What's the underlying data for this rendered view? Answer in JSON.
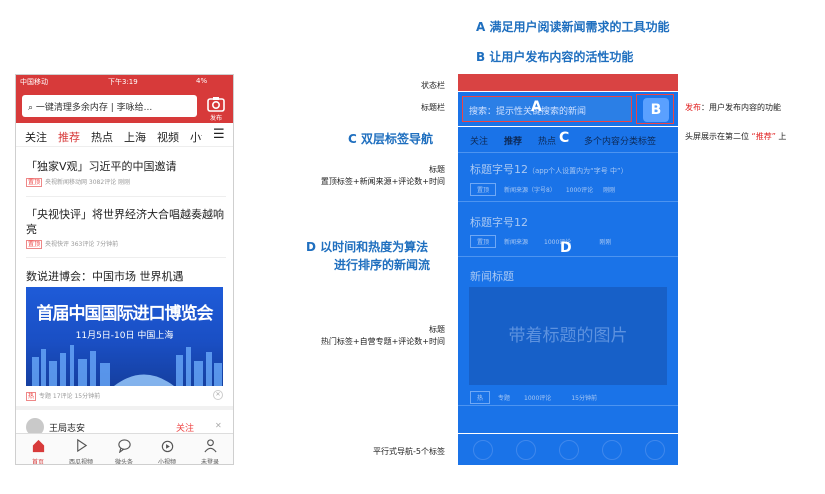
{
  "headings": {
    "a": "A 满足用户阅读新闻需求的工具功能",
    "b": "B 让用户发布内容的活性功能",
    "c": "C 双层标签导航",
    "d1": "D 以时间和热度为算法",
    "d2": "进行排序的新闻流"
  },
  "left_labels": {
    "status": "状态栏",
    "title": "标题栏",
    "news1_l1": "标题",
    "news1_l2": "置顶标签+新闻来源+评论数+时间",
    "news3_l1": "标题",
    "news3_l2": "热门标签+自营专题+评论数+时间",
    "bottom": "平行式导航-5个标签"
  },
  "right_labels": {
    "publish_red": "发布",
    "publish_rest": "：用户发布内容的功能",
    "tab_pre": "头屏展示在第二位 ",
    "tab_quote": "“推荐”",
    "tab_post": " 上"
  },
  "phone": {
    "status": {
      "carrier": "中国移动",
      "time": "下午3:19",
      "battery": "4%"
    },
    "search_text": "一键清理多余内存 | 李咏给...",
    "publish_label": "发布",
    "tabs": [
      "关注",
      "推荐",
      "热点",
      "上海",
      "视频",
      "小说"
    ],
    "news": [
      {
        "title": "「独家V观」习近平的中国邀请",
        "tag": "置顶",
        "meta": "央视新闻移动网  3082评论  刚刚"
      },
      {
        "title": "「央视快评」将世界经济大合唱越奏越响亮",
        "tag": "置顶",
        "meta": "央视快评  363评论  7分钟前"
      },
      {
        "title": "数说进博会：中国市场 世界机遇",
        "tag": "热",
        "meta": "专题  17评论  15分钟前"
      }
    ],
    "banner": {
      "line1": "首届中国国际进口博览会",
      "line2": "11月5日-10日    中国上海"
    },
    "next_user": "王局志安",
    "follow": "关注",
    "bottom_nav": [
      "首页",
      "西瓜视频",
      "微头条",
      "小视频",
      "未登录"
    ]
  },
  "wireframe": {
    "search_placeholder": "搜索：提示性关键搜索的新闻",
    "letter_a": "A",
    "letter_b": "B",
    "letter_c": "C",
    "letter_d": "D",
    "tabs": [
      "关注",
      "推荐",
      "热点",
      "多个内容分类标签"
    ],
    "item1": {
      "title": "标题字号12",
      "note": "（app个人设置内为“字号 中”）",
      "tag": "置顶",
      "source": "新闻来源（字号8）",
      "comments": "1000评论",
      "time": "刚刚"
    },
    "item2": {
      "title": "标题字号12",
      "tag": "置顶",
      "source": "新闻来源",
      "comments": "1000评论",
      "time": "刚刚"
    },
    "item3": {
      "title": "新闻标题",
      "image_text": "带着标题的图片",
      "tag": "热",
      "topic": "专题",
      "comments": "1000评论",
      "time": "15分钟前"
    }
  },
  "colors": {
    "accent_red": "#d73a3a",
    "wire_blue": "#1a73e8",
    "heading_blue": "#1f6fbf"
  }
}
